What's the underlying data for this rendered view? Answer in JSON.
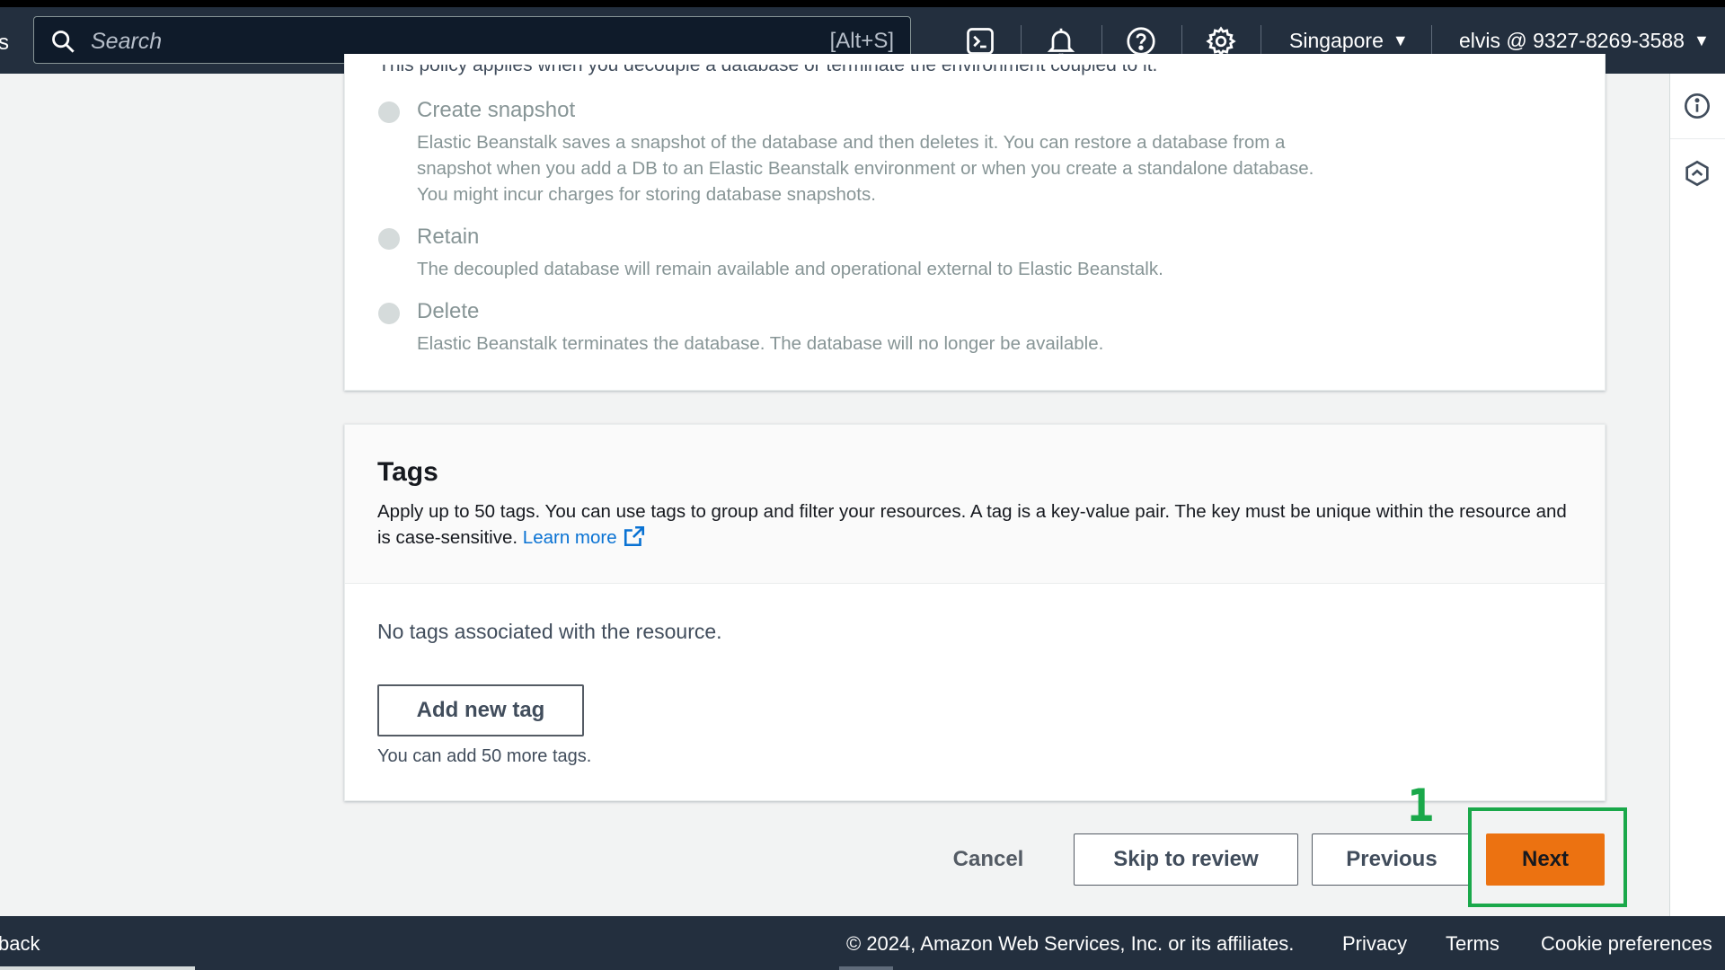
{
  "nav": {
    "edge_text": "s",
    "search_placeholder": "Search",
    "search_shortcut": "[Alt+S]",
    "region": "Singapore",
    "account": "elvis @ 9327-8269-3588",
    "icons": [
      "cloudshell-icon",
      "bell-icon",
      "help-icon",
      "gear-icon"
    ]
  },
  "db_policy": {
    "intro": "This policy applies when you decouple a database or terminate the environment coupled to it.",
    "options": [
      {
        "label": "Create snapshot",
        "desc": "Elastic Beanstalk saves a snapshot of the database and then deletes it. You can restore a database from a snapshot when you add a DB to an Elastic Beanstalk environment or when you create a standalone database. You might incur charges for storing database snapshots."
      },
      {
        "label": "Retain",
        "desc": "The decoupled database will remain available and operational external to Elastic Beanstalk."
      },
      {
        "label": "Delete",
        "desc": "Elastic Beanstalk terminates the database. The database will no longer be available."
      }
    ]
  },
  "tags": {
    "title": "Tags",
    "desc": "Apply up to 50 tags. You can use tags to group and filter your resources. A tag is a key-value pair. The key must be unique within the resource and is case-sensitive.",
    "learn_more": "Learn more",
    "empty": "No tags associated with the resource.",
    "add_button": "Add new tag",
    "remaining": "You can add 50 more tags."
  },
  "actions": {
    "cancel": "Cancel",
    "skip": "Skip to review",
    "previous": "Previous",
    "next": "Next"
  },
  "annotation": {
    "step": "1",
    "color": "#1aa84a"
  },
  "footer": {
    "feedback": "back",
    "copyright": "© 2024, Amazon Web Services, Inc. or its affiliates.",
    "privacy": "Privacy",
    "terms": "Terms",
    "cookies": "Cookie preferences"
  },
  "colors": {
    "nav_bg": "#232f3e",
    "primary": "#ec7211",
    "link": "#0972d3"
  }
}
